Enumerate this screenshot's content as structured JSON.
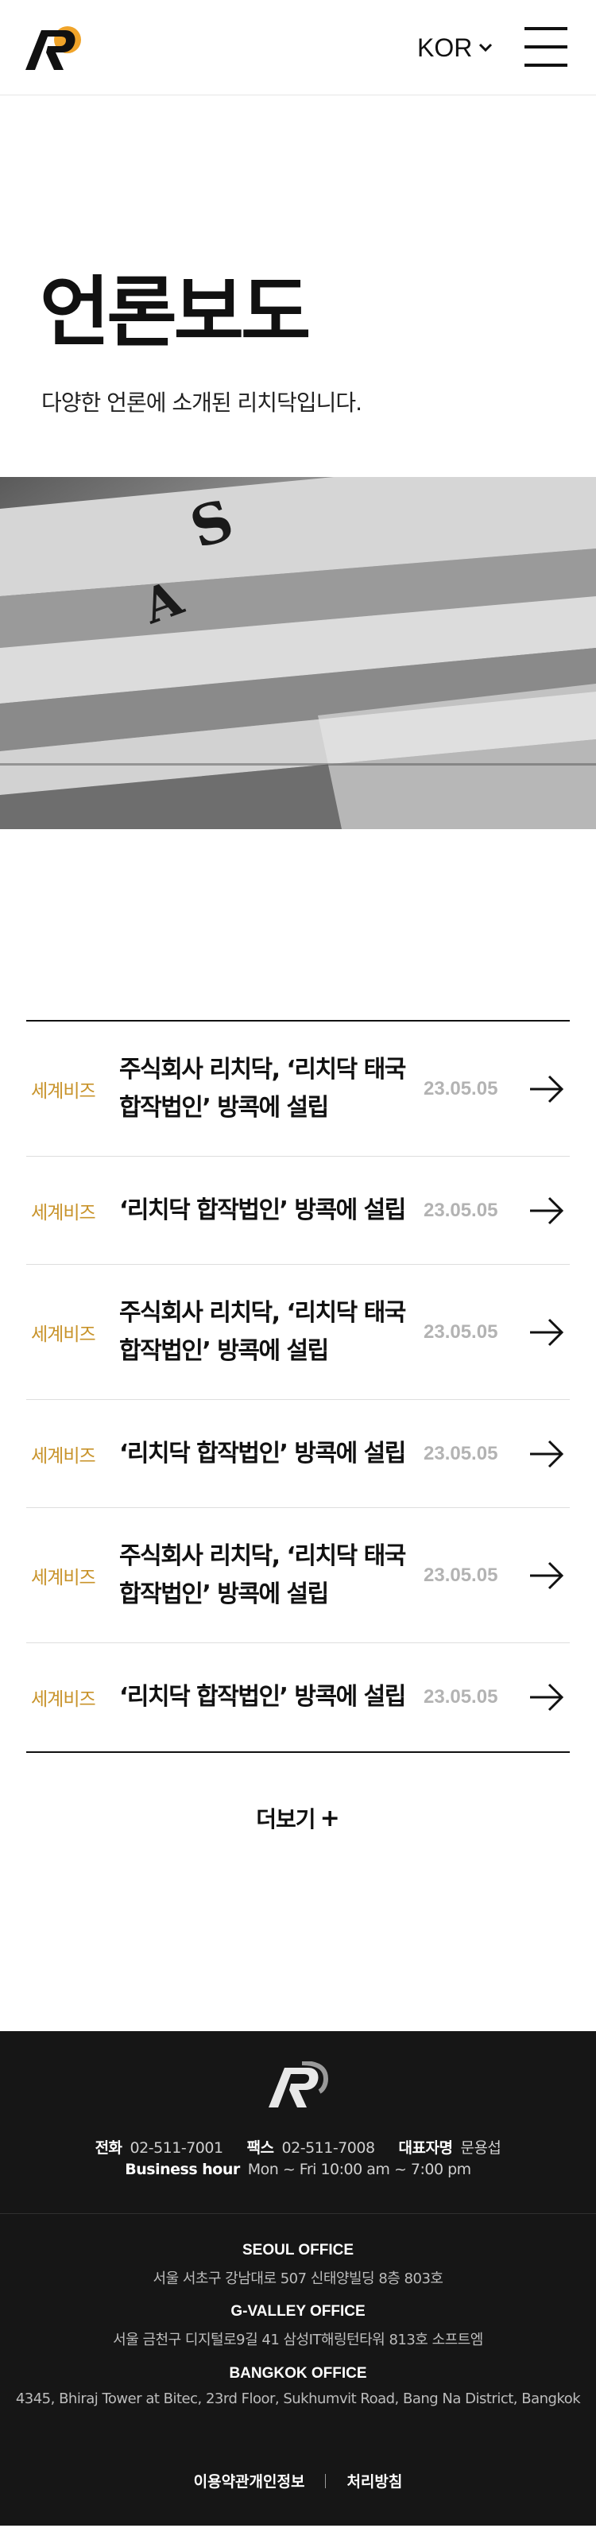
{
  "header": {
    "language": "KOR",
    "icons": {
      "logo": "rp-logo",
      "language_toggle": "chevron-down-icon",
      "menu": "hamburger-menu-icon"
    },
    "colors": {
      "logo_accent": "#f0a42a"
    }
  },
  "hero": {
    "title": "언론보도",
    "subtitle": "다양한 언론에 소개된 리치닥입니다.",
    "image_icon": "newspaper-stack-photo"
  },
  "press": {
    "items": [
      {
        "source": "세계비즈",
        "title": "주식회사 리치닥, ‘리치닥 태국 합작법인’ 방콕에 설립",
        "date": "23.05.05"
      },
      {
        "source": "세계비즈",
        "title": "‘리치닥 합작법인’ 방콕에 설립",
        "date": "23.05.05"
      },
      {
        "source": "세계비즈",
        "title": "주식회사 리치닥, ‘리치닥 태국 합작법인’ 방콕에 설립",
        "date": "23.05.05"
      },
      {
        "source": "세계비즈",
        "title": "‘리치닥 합작법인’ 방콕에 설립",
        "date": "23.05.05"
      },
      {
        "source": "세계비즈",
        "title": "주식회사 리치닥, ‘리치닥 태국 합작법인’ 방콕에 설립",
        "date": "23.05.05"
      },
      {
        "source": "세계비즈",
        "title": "‘리치닥 합작법인’ 방콕에 설립",
        "date": "23.05.05"
      }
    ],
    "more_label": "더보기",
    "more_icon": "plus-icon",
    "row_arrow_icon": "arrow-right-icon",
    "colors": {
      "source": "#c8932a",
      "date": "#b3b3b3"
    }
  },
  "footer": {
    "phone_label": "전화",
    "phone": "02-511-7001",
    "fax_label": "팩스",
    "fax": "02-511-7008",
    "ceo_label": "대표자명",
    "ceo": "문용섭",
    "hours_label": "Business hour",
    "hours": "Mon ~ Fri 10:00 am ~ 7:00 pm",
    "offices": [
      {
        "name": "SEOUL OFFICE",
        "address": "서울 서초구 강남대로 507 신태양빌딩 8층 803호"
      },
      {
        "name": "G-VALLEY OFFICE",
        "address": "서울 금천구 디지털로9길 41 삼성IT해링턴타워 813호 소프트엠"
      },
      {
        "name": "BANGKOK OFFICE",
        "address": "4345, Bhiraj Tower at Bitec, 23rd Floor, Sukhumvit Road, Bang Na District, Bangkok"
      }
    ],
    "links": {
      "terms": "이용약관개인정보",
      "policy": "처리방침"
    },
    "colors": {
      "background": "#161616"
    }
  }
}
